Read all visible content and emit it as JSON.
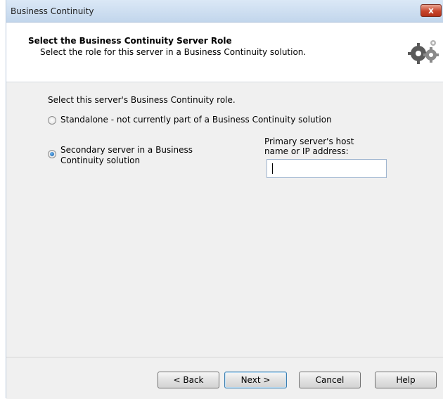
{
  "window": {
    "title": "Business Continuity",
    "close_label": "x"
  },
  "header": {
    "title": "Select the Business Continuity Server Role",
    "subtitle": "Select the role for this server in a Business Continuity solution.",
    "icon": "gears-icon"
  },
  "content": {
    "prompt": "Select this server's Business Continuity role.",
    "options": [
      {
        "label": "Standalone - not currently part of a Business Continuity solution",
        "checked": false
      },
      {
        "label_line1": "Secondary server in a Business",
        "label_line2": "Continuity solution",
        "checked": true
      }
    ],
    "host_label_line1": "Primary server's host",
    "host_label_line2": "name or IP address:",
    "host_value": ""
  },
  "buttons": {
    "back": "< Back",
    "next": "Next >",
    "cancel": "Cancel",
    "help": "Help"
  }
}
